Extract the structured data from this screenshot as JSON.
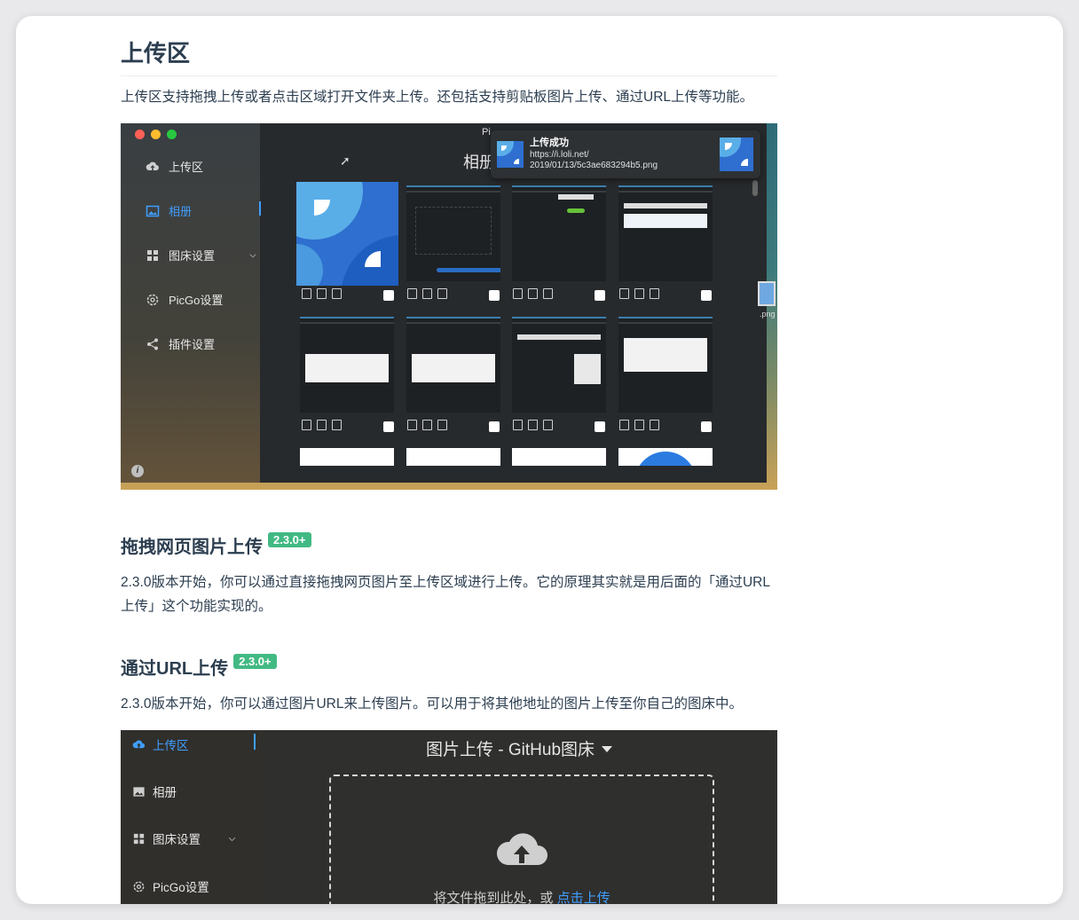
{
  "section": {
    "title": "上传区",
    "intro": "上传区支持拖拽上传或者点击区域打开文件夹上传。还包括支持剪贴板图片上传、通过URL上传等功能。"
  },
  "drag_upload": {
    "title": "拖拽网页图片上传",
    "badge": "2.3.0+",
    "desc": "2.3.0版本开始，你可以通过直接拖拽网页图片至上传区域进行上传。它的原理其实就是用后面的「通过URL上传」这个功能实现的。"
  },
  "url_upload": {
    "title": "通过URL上传",
    "badge": "2.3.0+",
    "desc": "2.3.0版本开始，你可以通过图片URL来上传图片。可以用于将其他地址的图片上传至你自己的图床中。"
  },
  "shot1": {
    "window_title": "Pi",
    "gallery_title": "相册",
    "sidebar": [
      "上传区",
      "相册",
      "图床设置",
      "PicGo设置",
      "插件设置"
    ],
    "notification": {
      "title": "上传成功",
      "url_line1": "https://i.loli.net/",
      "url_line2": "2019/01/13/5c3ae683294b5.png"
    },
    "desktop_file_label": ".png"
  },
  "shot2": {
    "sidebar": [
      "上传区",
      "相册",
      "图床设置",
      "PicGo设置"
    ],
    "upload_title": "图片上传 - GitHub图床",
    "drop_text": "将文件拖到此处，或",
    "drop_link": "点击上传"
  },
  "colors": {
    "accent": "#409eff",
    "badge": "#42b983"
  }
}
